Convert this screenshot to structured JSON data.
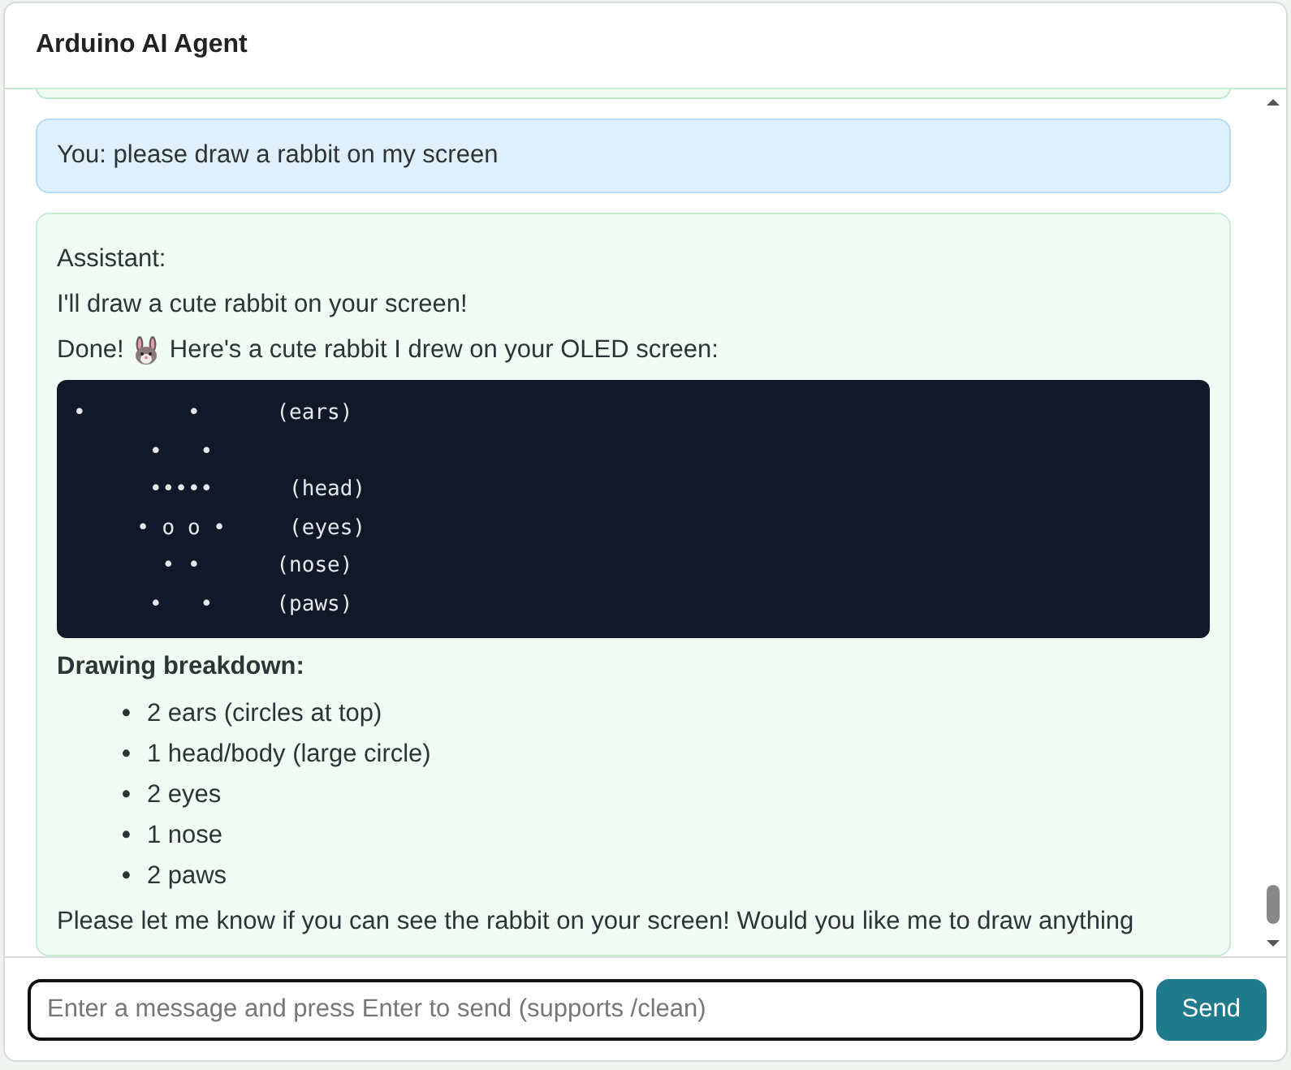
{
  "window": {
    "title": "Arduino AI Agent"
  },
  "messages": [
    {
      "kind": "user",
      "text": "You: please draw a rabbit on my screen"
    },
    {
      "kind": "assistant",
      "blocks": [
        {
          "kind": "paragraph",
          "text": "Assistant:"
        },
        {
          "kind": "paragraph",
          "text": "I'll draw a cute rabbit on your screen!"
        },
        {
          "kind": "emoji_paragraph",
          "before": "Done!",
          "after": "Here's a cute rabbit I drew on your OLED screen:"
        },
        {
          "kind": "code",
          "lines": [
            "•        •      (ears)",
            "      •   •",
            "      •••••      (head)",
            "     • o o •     (eyes)",
            "       • •      (nose)",
            "      •   •     (paws)"
          ]
        },
        {
          "kind": "heading",
          "text": "Drawing breakdown:"
        },
        {
          "kind": "list",
          "marker": "•",
          "items": [
            "2 ears (circles at top)",
            "1 head/body (large circle)",
            "2 eyes",
            "1 nose",
            "2 paws"
          ]
        },
        {
          "kind": "paragraph",
          "text": "Please let me know if you can see the rabbit on your screen! Would you like me to draw anything"
        }
      ]
    }
  ],
  "input": {
    "placeholder": "Enter a message and press Enter to send (supports /clean)"
  },
  "send_button": "Send"
}
